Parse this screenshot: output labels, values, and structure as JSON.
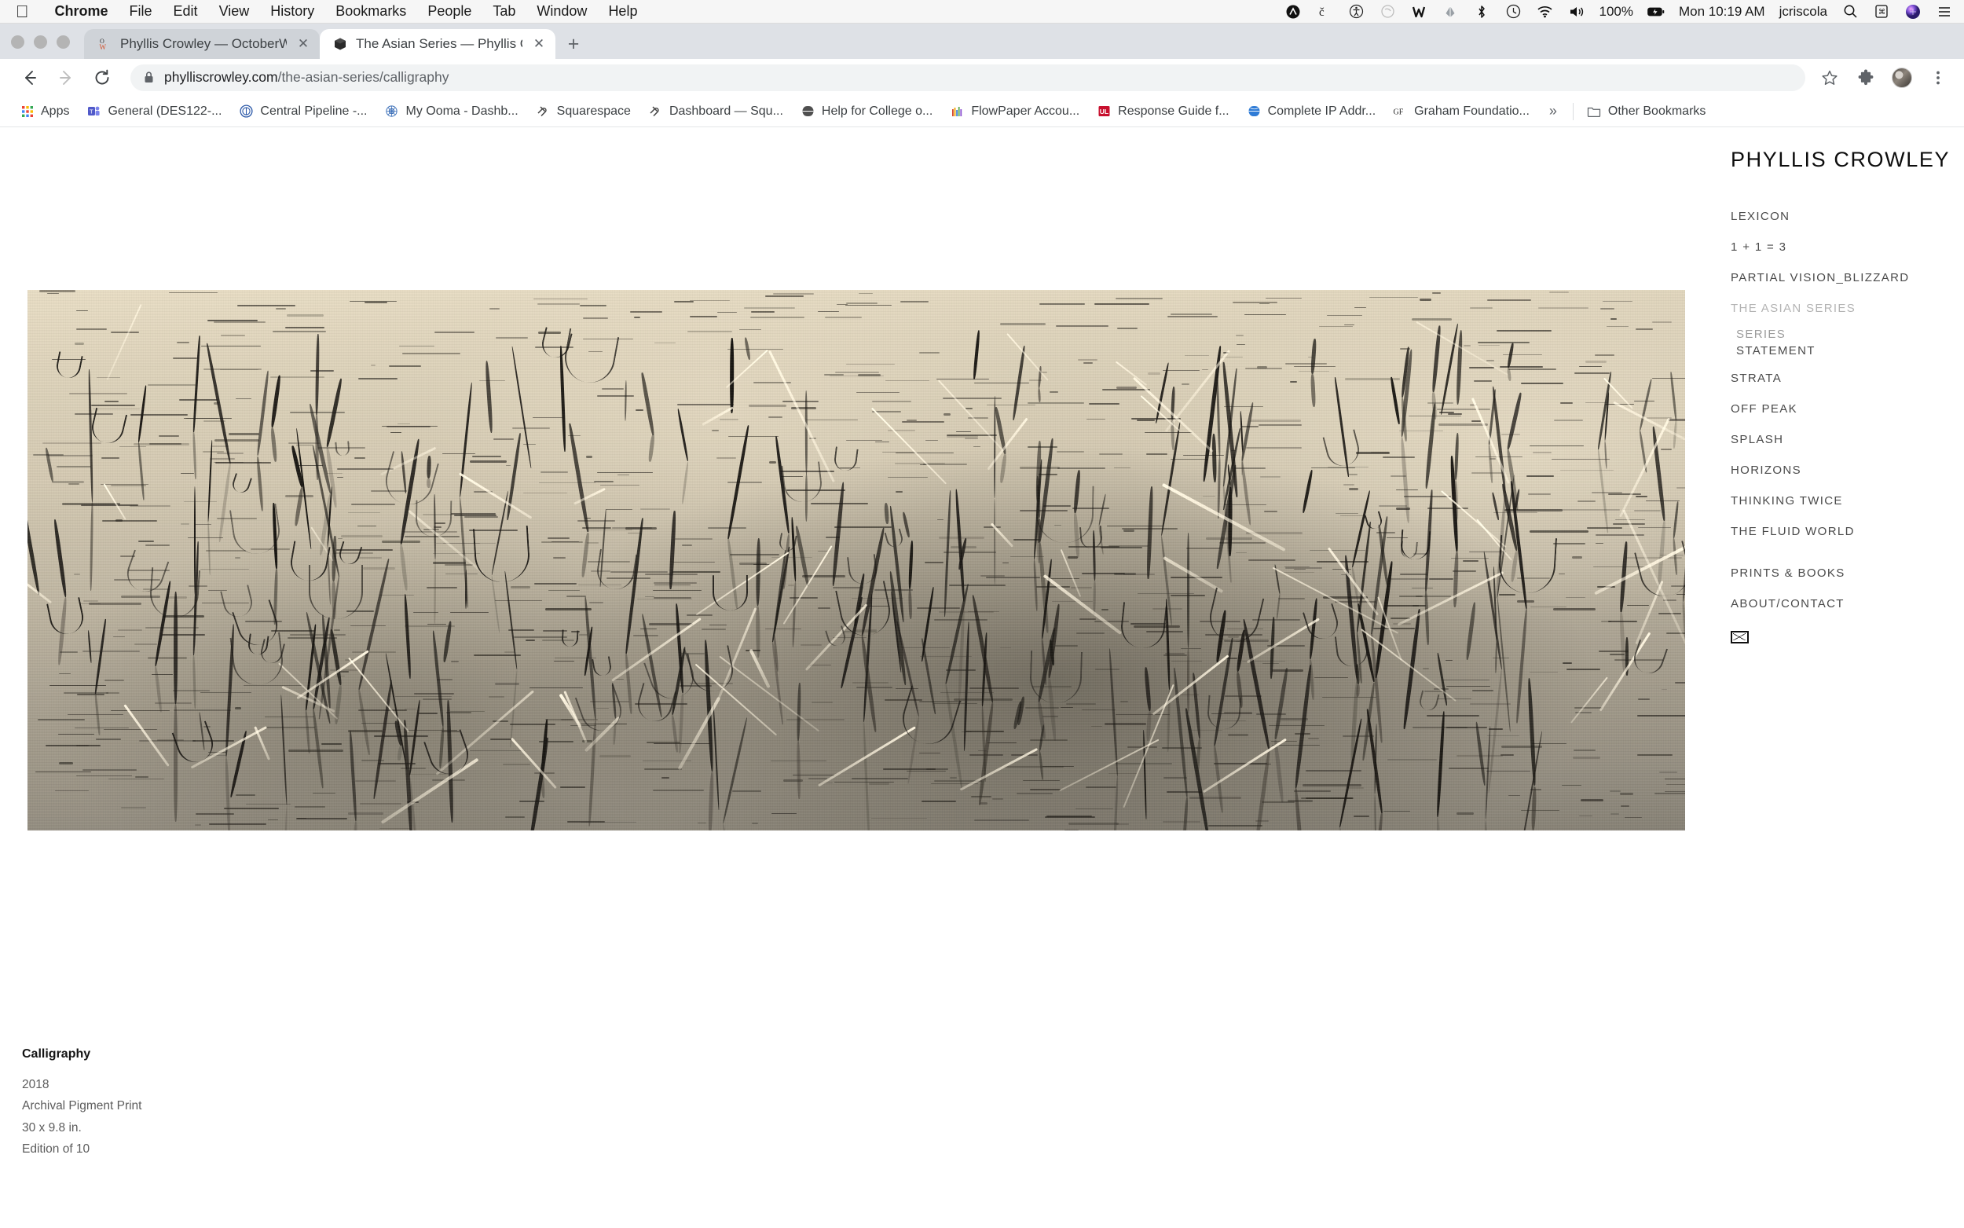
{
  "menubar": {
    "apple": "apple-logo",
    "items": [
      "Chrome",
      "File",
      "Edit",
      "View",
      "History",
      "Bookmarks",
      "People",
      "Tab",
      "Window",
      "Help"
    ],
    "status_icons": [
      "creative-cloud-icon",
      "grammarly-icon",
      "accessibility-icon",
      "airplay-icon",
      "malware-shield-icon",
      "dropbox-icon",
      "bluetooth-icon",
      "time-machine-icon",
      "wifi-icon",
      "volume-icon"
    ],
    "battery_percent": "100%",
    "battery_icon": "battery-charging-icon",
    "clock": "Mon 10:19 AM",
    "user": "jcriscola",
    "right_icons": [
      "spotlight-search-icon",
      "control-center-icon",
      "siri-icon",
      "notification-center-icon"
    ]
  },
  "tabs": [
    {
      "title": "Phyllis Crowley — OctoberWor",
      "favicon": "octoberworks-ow-icon",
      "active": false,
      "close": "✕"
    },
    {
      "title": "The Asian Series — Phyllis Cro",
      "favicon": "squarespace-cube-icon",
      "active": true,
      "close": "✕"
    }
  ],
  "new_tab_label": "+",
  "toolbar": {
    "back_icon": "back-arrow-icon",
    "forward_icon": "forward-arrow-icon",
    "reload_icon": "reload-icon",
    "lock_icon": "lock-icon",
    "url_domain": "phylliscrowley.com",
    "url_path": "/the-asian-series/calligraphy",
    "bookmark_star_icon": "star-icon",
    "extensions_icon": "puzzle-piece-icon",
    "profile_icon": "profile-avatar",
    "menu_icon": "three-dot-menu-icon"
  },
  "bookmarks": {
    "items": [
      {
        "label": "Apps",
        "icon": "apps-grid-icon"
      },
      {
        "label": "General (DES122-...",
        "icon": "teams-icon"
      },
      {
        "label": "Central Pipeline -...",
        "icon": "pipeline-icon"
      },
      {
        "label": "My Ooma - Dashb...",
        "icon": "ooma-icon"
      },
      {
        "label": "Squarespace",
        "icon": "squarespace-icon"
      },
      {
        "label": "Dashboard — Squ...",
        "icon": "squarespace-icon"
      },
      {
        "label": "Help for College o...",
        "icon": "globe-icon"
      },
      {
        "label": "FlowPaper Accou...",
        "icon": "flowpaper-icon"
      },
      {
        "label": "Response Guide f...",
        "icon": "ul-icon"
      },
      {
        "label": "Complete IP Addr...",
        "icon": "globe-blue-icon"
      },
      {
        "label": "Graham Foundatio...",
        "icon": "gf-icon"
      }
    ],
    "overflow": "»",
    "other_bookmarks": {
      "label": "Other Bookmarks",
      "icon": "folder-icon"
    }
  },
  "site": {
    "title": "PHYLLIS CROWLEY",
    "nav": [
      {
        "label": "LEXICON",
        "active": false,
        "sub": false
      },
      {
        "label": "1 + 1 = 3",
        "active": false,
        "sub": false
      },
      {
        "label": "PARTIAL VISION_BLIZZARD",
        "active": false,
        "sub": false
      },
      {
        "label": "THE ASIAN SERIES",
        "active": true,
        "sub": false
      }
    ],
    "sub_nav": [
      {
        "label": "SERIES",
        "muted": true
      },
      {
        "label": "STATEMENT",
        "muted": false
      }
    ],
    "nav2": [
      {
        "label": "STRATA"
      },
      {
        "label": "OFF PEAK"
      },
      {
        "label": "SPLASH"
      },
      {
        "label": "HORIZONS"
      },
      {
        "label": "THINKING TWICE"
      },
      {
        "label": "THE FLUID WORLD"
      }
    ],
    "nav3": [
      {
        "label": "PRINTS & BOOKS"
      },
      {
        "label": "ABOUT/CONTACT"
      }
    ],
    "mail_icon": "envelope-icon",
    "caption": {
      "title": "Calligraphy",
      "lines": [
        "2018",
        "Archival Pigment Print",
        "30 x 9.8 in.",
        "Edition of 10"
      ]
    },
    "artwork": {
      "name": "calligraphy-photograph",
      "description": "Black and white sepia-toned photograph of reeds and grasses in shallow water"
    }
  },
  "colors": {
    "chrome_tabstrip": "#dee1e6",
    "omnibox": "#f1f3f4",
    "nav_text": "#4a4a4a",
    "nav_active": "#b3b3b3",
    "caption_text": "#5c5c5c"
  }
}
